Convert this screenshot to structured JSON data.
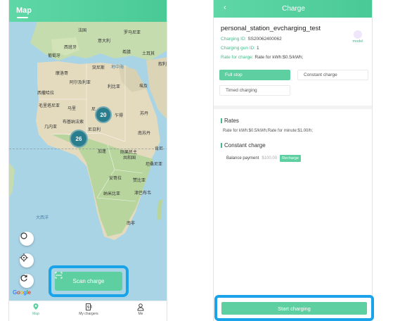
{
  "left": {
    "header_title": "Map",
    "map_labels": {
      "france": "法国",
      "romania": "罗马尼亚",
      "spain": "西班牙",
      "italy": "意大利",
      "portugal": "葡萄牙",
      "greece": "希腊",
      "turkey": "土耳其",
      "syria": "叙利",
      "morocco": "摩洛哥",
      "tunisia": "突尼斯",
      "mediterranean": "地中海",
      "algeria": "阿尔及利亚",
      "libya": "利比亚",
      "egypt": "埃及",
      "western_sahara": "西撒哈拉",
      "mauritania": "毛里塔尼亚",
      "mali": "马里",
      "niger": "尼",
      "chad": "乍得",
      "sudan": "苏丹",
      "guinea": "几内亚",
      "burkina": "布基纳法索",
      "nigeria": "尼日利",
      "south_sudan": "南苏丹",
      "gabon": "加蓬",
      "drc_1": "刚果民主",
      "drc_2": "共和国",
      "kenya": "肯尼",
      "tanzania": "坦桑尼亚",
      "angola": "安哥拉",
      "zambia": "赞比亚",
      "namibia": "纳米比亚",
      "zimbabwe": "津巴布韦",
      "south_africa": "南非",
      "atlantic": "大西洋"
    },
    "clusters": [
      {
        "count": "20"
      },
      {
        "count": "26"
      }
    ],
    "google": [
      "G",
      "o",
      "o",
      "g",
      "l",
      "e"
    ],
    "scan_label": "Scan charge",
    "nav": [
      {
        "label": "Map"
      },
      {
        "label": "My chargers"
      },
      {
        "label": "Me"
      }
    ]
  },
  "right": {
    "header_title": "Charge",
    "station_name": "personal_station_evcharging_test",
    "charging_id_label": "Charging ID:",
    "charging_id_value": "SS20062400062",
    "gun_id_label": "Charging gun ID:",
    "gun_id_value": "1",
    "rate_label": "Rate for charge:",
    "rate_value": "Rate for kWh:$0.5/kWh;",
    "model_label": "model",
    "modes": [
      "Full stop",
      "Constant charge",
      "Timed charging"
    ],
    "rates_title": "Rates",
    "rates_text": "Rate for kWh:$0.5/kWh;Rate for minute:$1.00/h;",
    "constant_title": "Constant charge",
    "balance_label": "Balance payment",
    "balance_amount": "$100.00",
    "recharge_label": "Recharge",
    "start_label": "Start charging"
  },
  "colors": {
    "accent": "#5dcfa0",
    "highlight": "#1aa3e8",
    "cluster": "#2a7d8c",
    "sea": "#a9d4e6",
    "land": "#bfd9a6",
    "desert": "#e6dcc1"
  }
}
